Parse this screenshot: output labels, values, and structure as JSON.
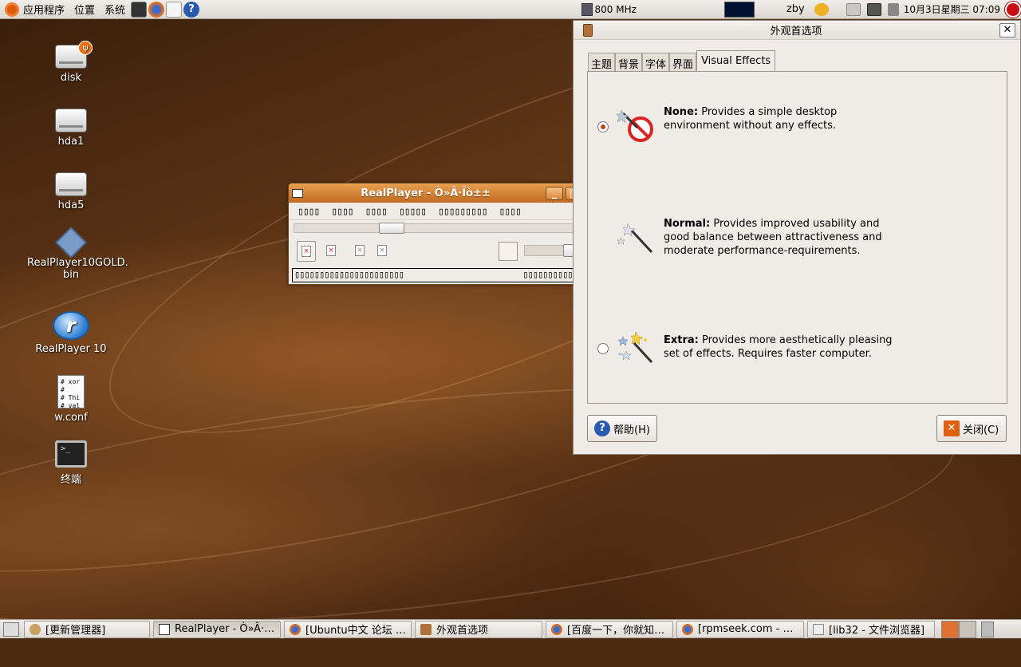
{
  "top_panel": {
    "menus": [
      "应用程序",
      "位置",
      "系统"
    ],
    "cpu_freq": "800 MHz",
    "user": "zby",
    "clock": "10月3日星期三 07:09"
  },
  "desktop": {
    "icons": [
      {
        "label": "disk"
      },
      {
        "label": "hda1"
      },
      {
        "label": "hda5"
      },
      {
        "label": "RealPlayer10GOLD.\nbin"
      },
      {
        "label": "RealPlayer 10"
      },
      {
        "label": "w.conf",
        "preview": "# xor\n#\n# Thi\n# val"
      },
      {
        "label": "终端"
      }
    ]
  },
  "realplayer": {
    "title": "RealPlayer - Ò»Â·Ïò±±",
    "menu": [
      "▯▯▯▯",
      "▯▯▯▯",
      "▯▯▯▯",
      "▯▯▯▯▯",
      "▯▯▯▯▯▯▯▯▯",
      "▯▯▯▯"
    ],
    "status_left": "▯▯▯▯▯▯▯▯▯▯▯▯▯▯▯▯▯▯▯▯▯▯",
    "status_right": "▯▯▯▯▯▯▯▯▯▯▯▯▯▯▯▯",
    "seek_position": 0.3,
    "volume_level": 0.75
  },
  "appearance": {
    "title": "外观首选项",
    "tabs": [
      "主题",
      "背景",
      "字体",
      "界面",
      "Visual Effects"
    ],
    "active_tab": "Visual Effects",
    "effects": [
      {
        "name": "None:",
        "desc": "Provides a simple desktop environment without any effects.",
        "selected": true
      },
      {
        "name": "Normal:",
        "desc": "Provides improved usability and good balance between attractiveness and moderate performance-requirements.",
        "selected": false
      },
      {
        "name": "Extra:",
        "desc": "Provides more aesthetically pleasing set of effects. Requires faster computer.",
        "selected": false
      }
    ],
    "help_label": "帮助(H)",
    "close_label": "关闭(C)"
  },
  "taskbar": {
    "tasks": [
      {
        "label": "[更新管理器]",
        "active": false
      },
      {
        "label": "RealPlayer - Ò»Â·…",
        "active": true
      },
      {
        "label": "[Ubuntu中文 论坛 …",
        "active": false
      },
      {
        "label": "外观首选项",
        "active": false
      },
      {
        "label": "[百度一下，你就知…",
        "active": false
      },
      {
        "label": "[rpmseek.com - …",
        "active": false
      },
      {
        "label": "[lib32 - 文件浏览器]",
        "active": false
      }
    ]
  },
  "colors": {
    "panel": "#dcd8d0",
    "window_title_orange": "#c06a20",
    "radio_selected": "#c24010",
    "desktop_brown": "#5e3516"
  }
}
